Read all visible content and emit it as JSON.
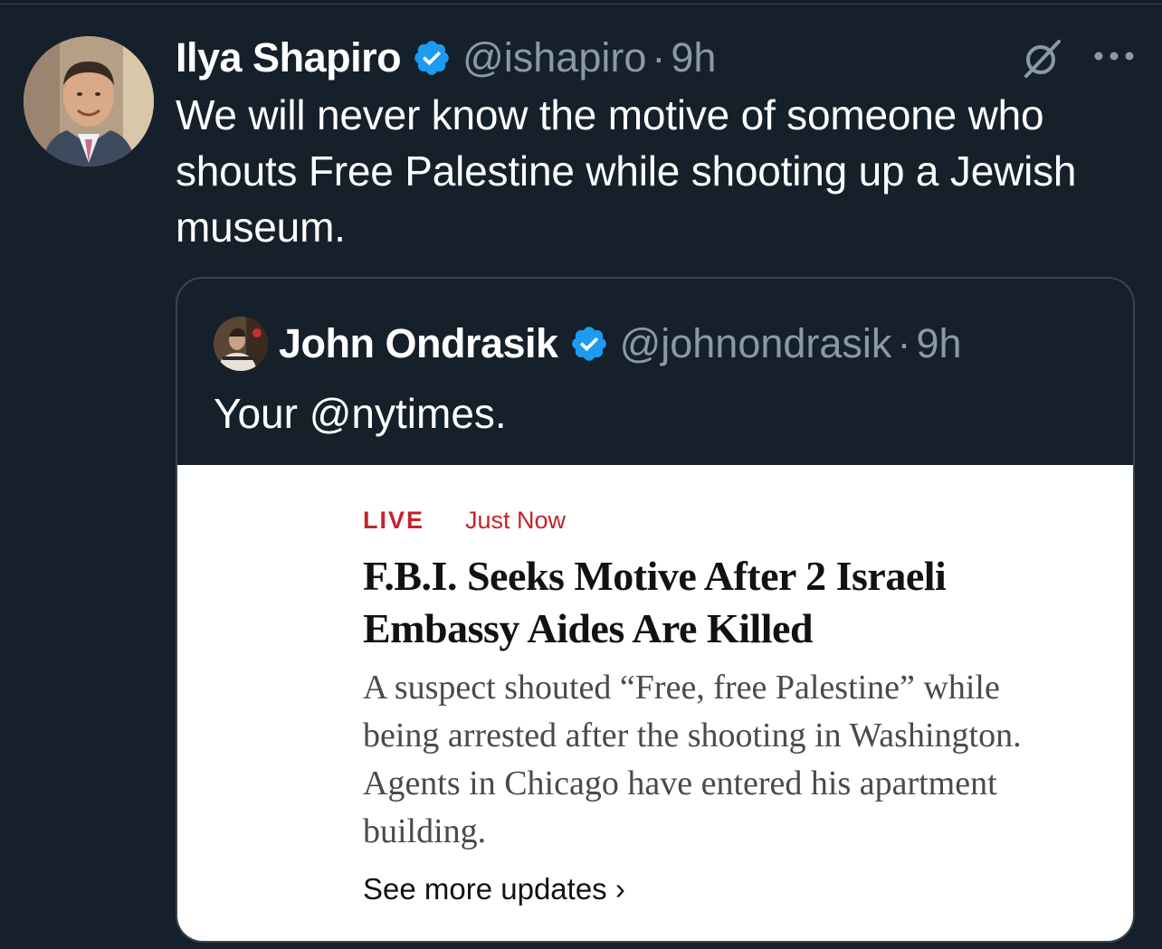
{
  "tweet": {
    "author_name": "Ilya Shapiro",
    "handle": "@ishapiro",
    "separator": "·",
    "time": "9h",
    "text": "We will never know the motive of someone who shouts Free Palestine while shooting up a Jewish museum.",
    "icons": {
      "verified": "verified-badge-icon",
      "grok": "grok-icon",
      "more": "more-options-icon"
    },
    "colors": {
      "background": "#15202b",
      "verified": "#1d9bf0",
      "secondary_text": "#8b98a5",
      "border": "#38444d"
    }
  },
  "quote": {
    "author_name": "John Ondrasik",
    "handle": "@johnondrasik",
    "separator": "·",
    "time": "9h",
    "text": "Your @nytimes.",
    "image": {
      "live_label": "LIVE",
      "time_label": "Just Now",
      "headline": "F.B.I. Seeks Motive After 2 Israeli Embassy Aides Are Killed",
      "summary": "A suspect shouted “Free, free Palestine” while being arrested after the shooting in Washington. Agents in Chicago have entered his apartment building.",
      "more_link": "See more updates ›",
      "colors": {
        "live": "#c5232a",
        "headline": "#121212",
        "summary": "#4a4a4a"
      }
    }
  }
}
